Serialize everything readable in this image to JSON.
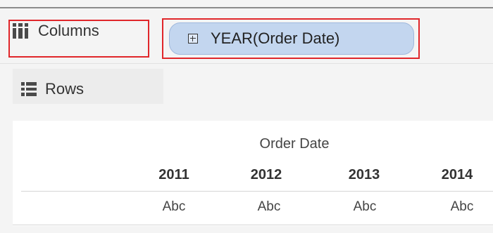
{
  "shelves": {
    "columns": {
      "label": "Columns",
      "pill": "YEAR(Order Date)"
    },
    "rows": {
      "label": "Rows"
    }
  },
  "view": {
    "header": "Order Date",
    "years": [
      "2011",
      "2012",
      "2013",
      "2014"
    ],
    "cells": [
      "Abc",
      "Abc",
      "Abc",
      "Abc"
    ]
  },
  "colors": {
    "highlight_border": "#e0262a",
    "pill_fill": "#c3d6ef",
    "shelf_bg": "#f4f4f4"
  },
  "icons": {
    "columns": "columns-icon",
    "rows": "rows-icon",
    "pill_expand": "expand-plus-icon"
  }
}
